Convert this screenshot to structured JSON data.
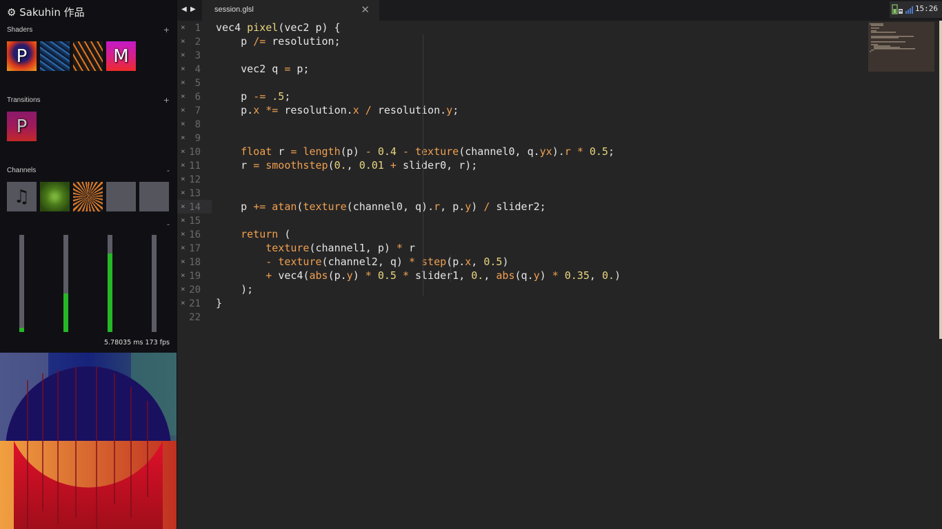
{
  "app": {
    "title": "⚙ Sakuhin 作品"
  },
  "sections": {
    "shaders": {
      "label": "Shaders",
      "action": "+"
    },
    "transitions": {
      "label": "Transitions",
      "action": "+"
    },
    "channels": {
      "label": "Channels",
      "action": "-"
    },
    "sliders_action": "-"
  },
  "shader_thumbs": [
    {
      "letter": "P"
    },
    {
      "letter": ""
    },
    {
      "letter": ""
    },
    {
      "letter": "M"
    }
  ],
  "transition_thumbs": [
    {
      "letter": "P"
    }
  ],
  "channels": [
    {
      "icon": "music-note-icon",
      "glyph": "♫"
    },
    {
      "icon": ""
    },
    {
      "icon": ""
    },
    {
      "icon": ""
    },
    {
      "icon": ""
    }
  ],
  "sliders": [
    {
      "value": 0.04
    },
    {
      "value": 0.4
    },
    {
      "value": 0.81
    },
    {
      "value": 0.0
    }
  ],
  "perf": "5.78035 ms 173 fps",
  "editor": {
    "tab_nav_back": "◀",
    "tab_nav_fwd": "▶",
    "tab_label": "session.glsl",
    "tab_close": "✕",
    "gutter_mark": "×",
    "current_line": 14
  },
  "tray": {
    "clock": "15:26"
  },
  "code_lines": [
    "vec4 pixel(vec2 p) {",
    "    p /= resolution;",
    "",
    "    vec2 q = p;",
    "",
    "    p -= .5;",
    "    p.x *= resolution.x / resolution.y;",
    "",
    "",
    "    float r = length(p) - 0.4 - texture(channel0, q.yx).r * 0.5;",
    "    r = smoothstep(0., 0.01 + slider0, r);",
    "",
    "",
    "    p += atan(texture(channel0, q).r, p.y) / slider2;",
    "",
    "    return (",
    "        texture(channel1, p) * r",
    "        - texture(channel2, q) * step(p.x, 0.5)",
    "        + vec4(abs(p.y) * 0.5 * slider1, 0., abs(q.y) * 0.35, 0.)",
    "    );",
    "}",
    ""
  ],
  "colors": {
    "keyword": "#f2a14b",
    "number": "#e9d67c",
    "slider_fill": "#26b826"
  }
}
